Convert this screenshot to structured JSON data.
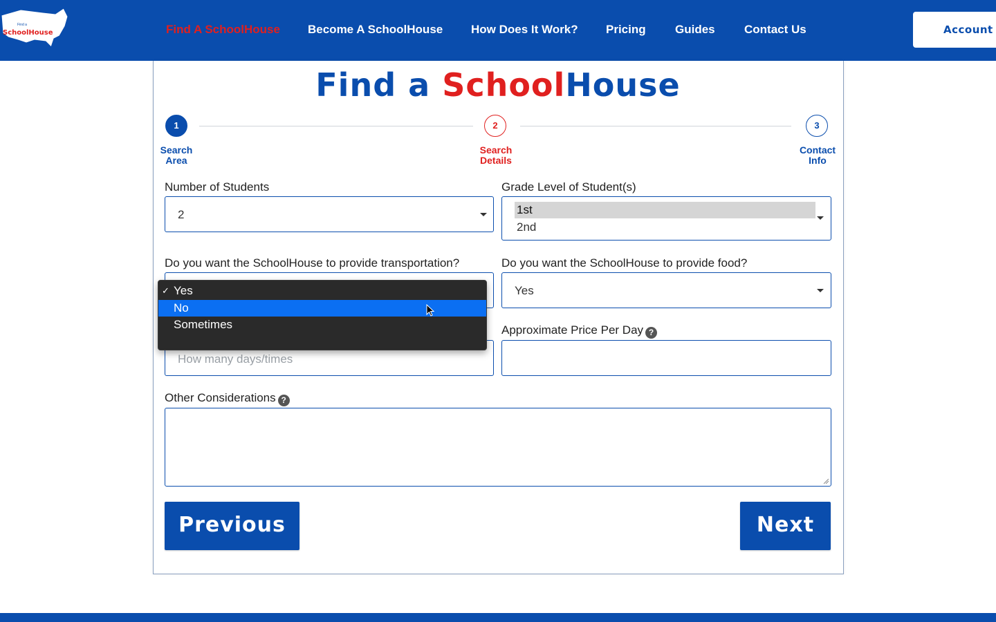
{
  "header": {
    "logo_text": "SchoolHouse",
    "logo_small": "Find a",
    "nav": [
      {
        "label": "Find A SchoolHouse",
        "active": true
      },
      {
        "label": "Become A SchoolHouse",
        "active": false
      },
      {
        "label": "How Does It Work?",
        "active": false
      },
      {
        "label": "Pricing",
        "active": false
      },
      {
        "label": "Guides",
        "active": false
      },
      {
        "label": "Contact Us",
        "active": false
      }
    ],
    "account_label": "Account"
  },
  "title": {
    "part1": "Find a ",
    "part2": "School",
    "part3": "House"
  },
  "steps": [
    {
      "number": "1",
      "label_line1": "Search",
      "label_line2": "Area",
      "state": "completed"
    },
    {
      "number": "2",
      "label_line1": "Search",
      "label_line2": "Details",
      "state": "current"
    },
    {
      "number": "3",
      "label_line1": "Contact",
      "label_line2": "Info",
      "state": "upcoming"
    }
  ],
  "form": {
    "num_students_label": "Number of Students",
    "num_students_value": "2",
    "grade_label": "Grade Level of Student(s)",
    "grade_options": [
      "1st",
      "2nd"
    ],
    "grade_selected": "1st",
    "transport_label": "Do you want the SchoolHouse to provide transportation?",
    "transport_options": [
      "Yes",
      "No",
      "Sometimes"
    ],
    "transport_selected": "Yes",
    "transport_hovered": "No",
    "food_label": "Do you want the SchoolHouse to provide food?",
    "food_value": "Yes",
    "days_placeholder": "How many days/times",
    "price_label": "Approximate Price Per Day",
    "other_label": "Other Considerations",
    "help_glyph": "?"
  },
  "buttons": {
    "previous": "Previous",
    "next": "Next"
  },
  "colors": {
    "brand_blue": "#0a4dad",
    "brand_red": "#e0201f",
    "highlight": "#0b6ff2"
  }
}
